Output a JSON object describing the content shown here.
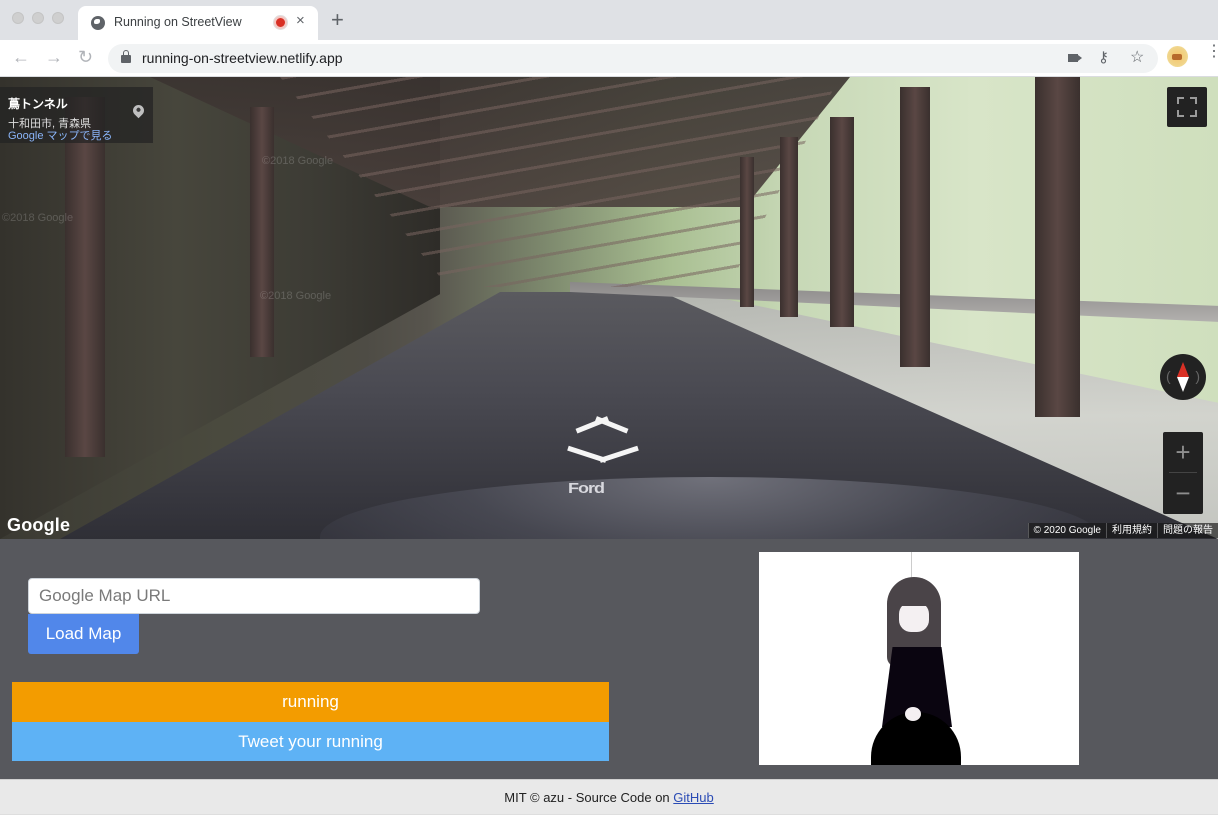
{
  "browser": {
    "tab": {
      "title": "Running on StreetView",
      "favicon": "globe-icon",
      "recording_indicator": "recording-icon",
      "close_glyph": "×"
    },
    "new_tab_glyph": "+",
    "nav": {
      "back_glyph": "←",
      "forward_glyph": "→",
      "reload_glyph": "↻"
    },
    "url": "running-on-streetview.netlify.app",
    "toolbar_icons": [
      "camera-icon",
      "key-icon",
      "star-icon",
      "profile-avatar",
      "menu-icon"
    ],
    "key_glyph": "⚷",
    "star_glyph": "☆",
    "menu_glyph": "⋮"
  },
  "streetview": {
    "place_card": {
      "name": "蔦トンネル",
      "address": "十和田市, 青森県",
      "link": "Google マップで見る"
    },
    "watermarks": [
      "©2018 Google",
      "©2018 Google",
      "©2018 Google"
    ],
    "road_label": "Ford",
    "logo": "Google",
    "footer": {
      "copyright": "© 2020 Google",
      "terms": "利用規約",
      "report": "問題の報告"
    },
    "controls": {
      "zoom_in": "+",
      "zoom_out": "−"
    }
  },
  "form": {
    "url_placeholder": "Google Map URL",
    "url_value": "",
    "load_button": "Load Map"
  },
  "actions": {
    "running_button": "running",
    "tweet_button": "Tweet your running"
  },
  "colors": {
    "running": "#f39c00",
    "tweet": "#5eb2f5",
    "load": "#5187ea",
    "content_bg": "#57585d"
  },
  "footer": {
    "prefix": "MIT © azu - Source Code on ",
    "link": "GitHub"
  }
}
